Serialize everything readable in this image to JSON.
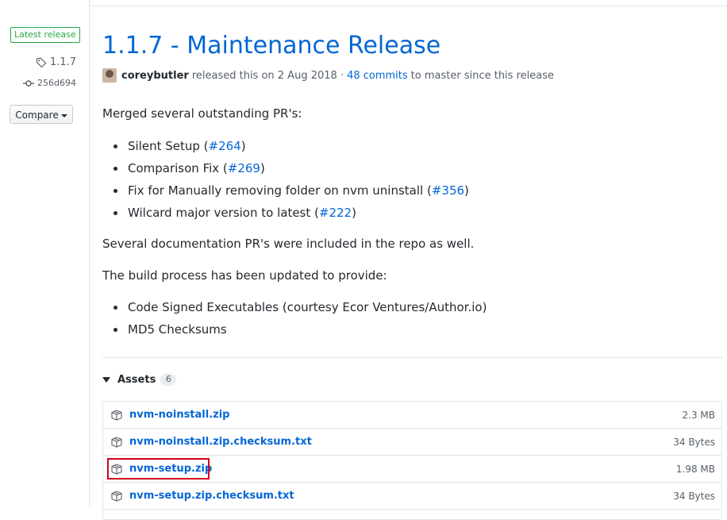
{
  "sidebar": {
    "latest_badge": "Latest release",
    "tag": "1.1.7",
    "commit": "256d694",
    "compare_label": "Compare"
  },
  "release": {
    "title": "1.1.7 - Maintenance Release",
    "author": "coreybutler",
    "released_text": "released this on 2 Aug 2018 ·",
    "commits_link": "48 commits",
    "since_text": "to master since this release"
  },
  "body": {
    "intro": "Merged several outstanding PR's:",
    "prs": [
      {
        "text": "Silent Setup (",
        "link": "#264",
        "tail": ")"
      },
      {
        "text": "Comparison Fix (",
        "link": "#269",
        "tail": ")"
      },
      {
        "text": "Fix for Manually removing folder on nvm uninstall (",
        "link": "#356",
        "tail": ")"
      },
      {
        "text": "Wilcard major version to latest (",
        "link": "#222",
        "tail": ")"
      }
    ],
    "docs_note": "Several documentation PR's were included in the repo as well.",
    "build_intro": "The build process has been updated to provide:",
    "build_items": [
      "Code Signed Executables (courtesy Ecor Ventures/Author.io)",
      "MD5 Checksums"
    ]
  },
  "assets": {
    "label": "Assets",
    "count": "6",
    "files": [
      {
        "name": "nvm-noinstall.zip",
        "size": "2.3 MB"
      },
      {
        "name": "nvm-noinstall.zip.checksum.txt",
        "size": "34 Bytes"
      },
      {
        "name": "nvm-setup.zip",
        "size": "1.98 MB"
      },
      {
        "name": "nvm-setup.zip.checksum.txt",
        "size": "34 Bytes"
      }
    ]
  },
  "colors": {
    "link": "#0366d6",
    "badge_green": "#28a745",
    "highlight_red": "#d0021b"
  }
}
